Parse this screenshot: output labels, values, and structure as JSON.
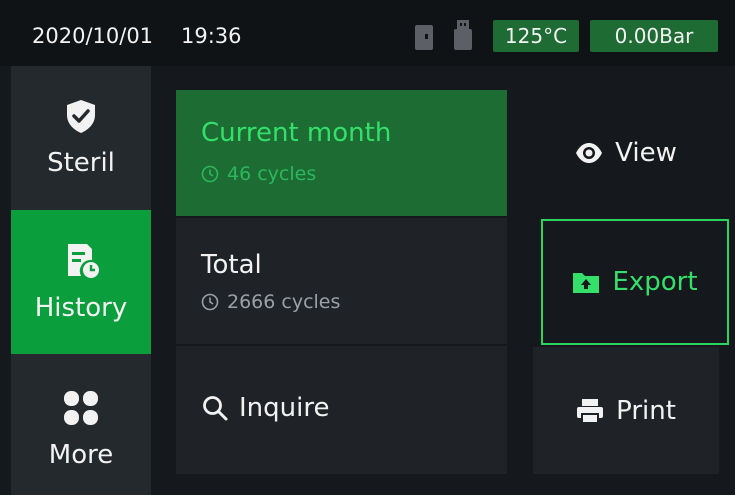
{
  "status": {
    "date": "2020/10/01",
    "time": "19:36",
    "temperature": "125°C",
    "pressure": "0.00Bar",
    "icons": [
      "sd-card-icon",
      "usb-icon"
    ],
    "badge_color": "#1f6b34"
  },
  "sidebar": {
    "items": [
      {
        "label": "Steril",
        "icon": "shield-check-icon",
        "active": false
      },
      {
        "label": "History",
        "icon": "history-doc-icon",
        "active": true
      },
      {
        "label": "More",
        "icon": "grid-icon",
        "active": false
      }
    ],
    "active_color": "#0b9e3c"
  },
  "records": {
    "current_month": {
      "title": "Current month",
      "cycles": "46 cycles"
    },
    "total": {
      "title": "Total",
      "cycles": "2666 cycles"
    },
    "inquire": {
      "label": "Inquire"
    }
  },
  "actions": {
    "view": "View",
    "export": "Export",
    "print": "Print"
  },
  "colors": {
    "accent": "#35e06a",
    "background": "#15181c",
    "panel": "#1f2328"
  }
}
